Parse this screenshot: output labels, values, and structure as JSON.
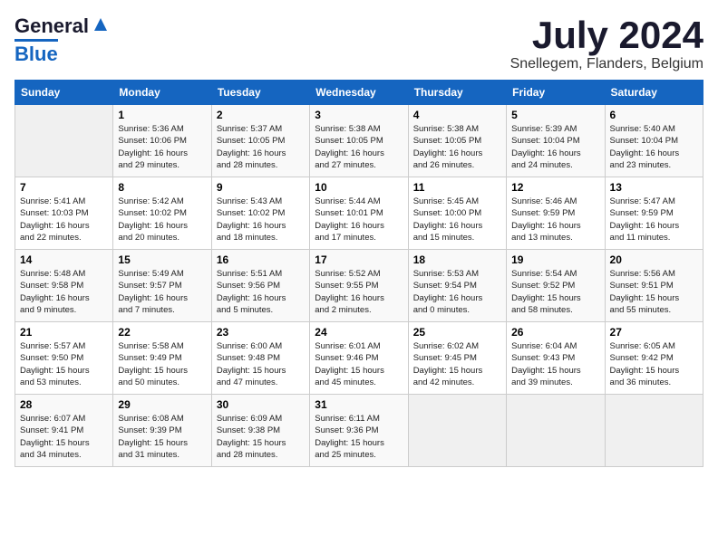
{
  "header": {
    "logo_general": "General",
    "logo_blue": "Blue",
    "month": "July 2024",
    "location": "Snellegem, Flanders, Belgium"
  },
  "days_of_week": [
    "Sunday",
    "Monday",
    "Tuesday",
    "Wednesday",
    "Thursday",
    "Friday",
    "Saturday"
  ],
  "weeks": [
    [
      {
        "day": "",
        "info": ""
      },
      {
        "day": "1",
        "info": "Sunrise: 5:36 AM\nSunset: 10:06 PM\nDaylight: 16 hours\nand 29 minutes."
      },
      {
        "day": "2",
        "info": "Sunrise: 5:37 AM\nSunset: 10:05 PM\nDaylight: 16 hours\nand 28 minutes."
      },
      {
        "day": "3",
        "info": "Sunrise: 5:38 AM\nSunset: 10:05 PM\nDaylight: 16 hours\nand 27 minutes."
      },
      {
        "day": "4",
        "info": "Sunrise: 5:38 AM\nSunset: 10:05 PM\nDaylight: 16 hours\nand 26 minutes."
      },
      {
        "day": "5",
        "info": "Sunrise: 5:39 AM\nSunset: 10:04 PM\nDaylight: 16 hours\nand 24 minutes."
      },
      {
        "day": "6",
        "info": "Sunrise: 5:40 AM\nSunset: 10:04 PM\nDaylight: 16 hours\nand 23 minutes."
      }
    ],
    [
      {
        "day": "7",
        "info": "Sunrise: 5:41 AM\nSunset: 10:03 PM\nDaylight: 16 hours\nand 22 minutes."
      },
      {
        "day": "8",
        "info": "Sunrise: 5:42 AM\nSunset: 10:02 PM\nDaylight: 16 hours\nand 20 minutes."
      },
      {
        "day": "9",
        "info": "Sunrise: 5:43 AM\nSunset: 10:02 PM\nDaylight: 16 hours\nand 18 minutes."
      },
      {
        "day": "10",
        "info": "Sunrise: 5:44 AM\nSunset: 10:01 PM\nDaylight: 16 hours\nand 17 minutes."
      },
      {
        "day": "11",
        "info": "Sunrise: 5:45 AM\nSunset: 10:00 PM\nDaylight: 16 hours\nand 15 minutes."
      },
      {
        "day": "12",
        "info": "Sunrise: 5:46 AM\nSunset: 9:59 PM\nDaylight: 16 hours\nand 13 minutes."
      },
      {
        "day": "13",
        "info": "Sunrise: 5:47 AM\nSunset: 9:59 PM\nDaylight: 16 hours\nand 11 minutes."
      }
    ],
    [
      {
        "day": "14",
        "info": "Sunrise: 5:48 AM\nSunset: 9:58 PM\nDaylight: 16 hours\nand 9 minutes."
      },
      {
        "day": "15",
        "info": "Sunrise: 5:49 AM\nSunset: 9:57 PM\nDaylight: 16 hours\nand 7 minutes."
      },
      {
        "day": "16",
        "info": "Sunrise: 5:51 AM\nSunset: 9:56 PM\nDaylight: 16 hours\nand 5 minutes."
      },
      {
        "day": "17",
        "info": "Sunrise: 5:52 AM\nSunset: 9:55 PM\nDaylight: 16 hours\nand 2 minutes."
      },
      {
        "day": "18",
        "info": "Sunrise: 5:53 AM\nSunset: 9:54 PM\nDaylight: 16 hours\nand 0 minutes."
      },
      {
        "day": "19",
        "info": "Sunrise: 5:54 AM\nSunset: 9:52 PM\nDaylight: 15 hours\nand 58 minutes."
      },
      {
        "day": "20",
        "info": "Sunrise: 5:56 AM\nSunset: 9:51 PM\nDaylight: 15 hours\nand 55 minutes."
      }
    ],
    [
      {
        "day": "21",
        "info": "Sunrise: 5:57 AM\nSunset: 9:50 PM\nDaylight: 15 hours\nand 53 minutes."
      },
      {
        "day": "22",
        "info": "Sunrise: 5:58 AM\nSunset: 9:49 PM\nDaylight: 15 hours\nand 50 minutes."
      },
      {
        "day": "23",
        "info": "Sunrise: 6:00 AM\nSunset: 9:48 PM\nDaylight: 15 hours\nand 47 minutes."
      },
      {
        "day": "24",
        "info": "Sunrise: 6:01 AM\nSunset: 9:46 PM\nDaylight: 15 hours\nand 45 minutes."
      },
      {
        "day": "25",
        "info": "Sunrise: 6:02 AM\nSunset: 9:45 PM\nDaylight: 15 hours\nand 42 minutes."
      },
      {
        "day": "26",
        "info": "Sunrise: 6:04 AM\nSunset: 9:43 PM\nDaylight: 15 hours\nand 39 minutes."
      },
      {
        "day": "27",
        "info": "Sunrise: 6:05 AM\nSunset: 9:42 PM\nDaylight: 15 hours\nand 36 minutes."
      }
    ],
    [
      {
        "day": "28",
        "info": "Sunrise: 6:07 AM\nSunset: 9:41 PM\nDaylight: 15 hours\nand 34 minutes."
      },
      {
        "day": "29",
        "info": "Sunrise: 6:08 AM\nSunset: 9:39 PM\nDaylight: 15 hours\nand 31 minutes."
      },
      {
        "day": "30",
        "info": "Sunrise: 6:09 AM\nSunset: 9:38 PM\nDaylight: 15 hours\nand 28 minutes."
      },
      {
        "day": "31",
        "info": "Sunrise: 6:11 AM\nSunset: 9:36 PM\nDaylight: 15 hours\nand 25 minutes."
      },
      {
        "day": "",
        "info": ""
      },
      {
        "day": "",
        "info": ""
      },
      {
        "day": "",
        "info": ""
      }
    ]
  ]
}
